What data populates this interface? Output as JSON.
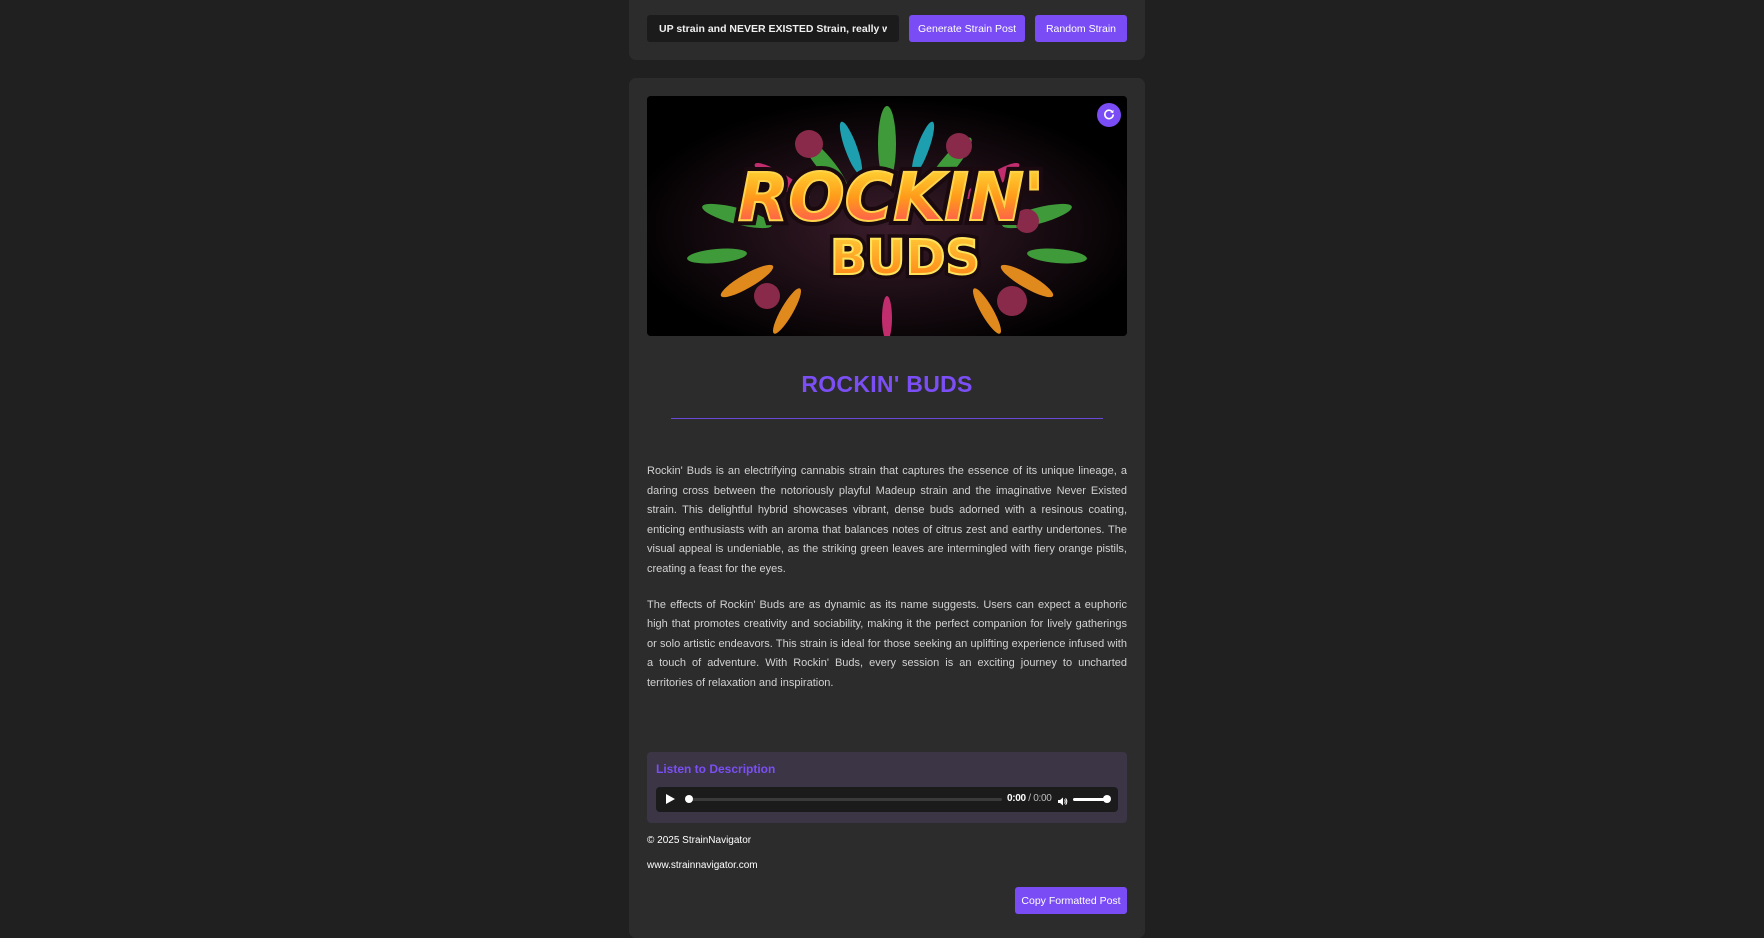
{
  "top_bar": {
    "prompt_value": "UP strain and NEVER EXISTED Strain, really wild stuff.",
    "generate_label": "Generate Strain Post",
    "random_label": "Random Strain"
  },
  "hero": {
    "logo_line1": "ROCKIN'",
    "logo_line2": "BUDS",
    "refresh_icon": "refresh-icon"
  },
  "strain": {
    "title": "ROCKIN' BUDS",
    "paragraphs": [
      "Rockin' Buds is an electrifying cannabis strain that captures the essence of its unique lineage, a daring cross between the notoriously playful Madeup strain and the imaginative Never Existed strain. This delightful hybrid showcases vibrant, dense buds adorned with a resinous coating, enticing enthusiasts with an aroma that balances notes of citrus zest and earthy undertones. The visual appeal is undeniable, as the striking green leaves are intermingled with fiery orange pistils, creating a feast for the eyes.",
      "The effects of Rockin' Buds are as dynamic as its name suggests. Users can expect a euphoric high that promotes creativity and sociability, making it the perfect companion for lively gatherings or solo artistic endeavors. This strain is ideal for those seeking an uplifting experience infused with a touch of adventure. With Rockin' Buds, every session is an exciting journey to uncharted territories of relaxation and inspiration."
    ]
  },
  "audio": {
    "label": "Listen to Description",
    "current_time": "0:00",
    "separator": " / ",
    "duration": "0:00",
    "progress": 0,
    "volume": 1
  },
  "footer": {
    "copyright": "© 2025 StrainNavigator",
    "url": "www.strainnavigator.com",
    "copy_label": "Copy Formatted Post"
  },
  "colors": {
    "accent": "#7a4cf5",
    "background": "#202020",
    "card": "#2c2c2c"
  }
}
